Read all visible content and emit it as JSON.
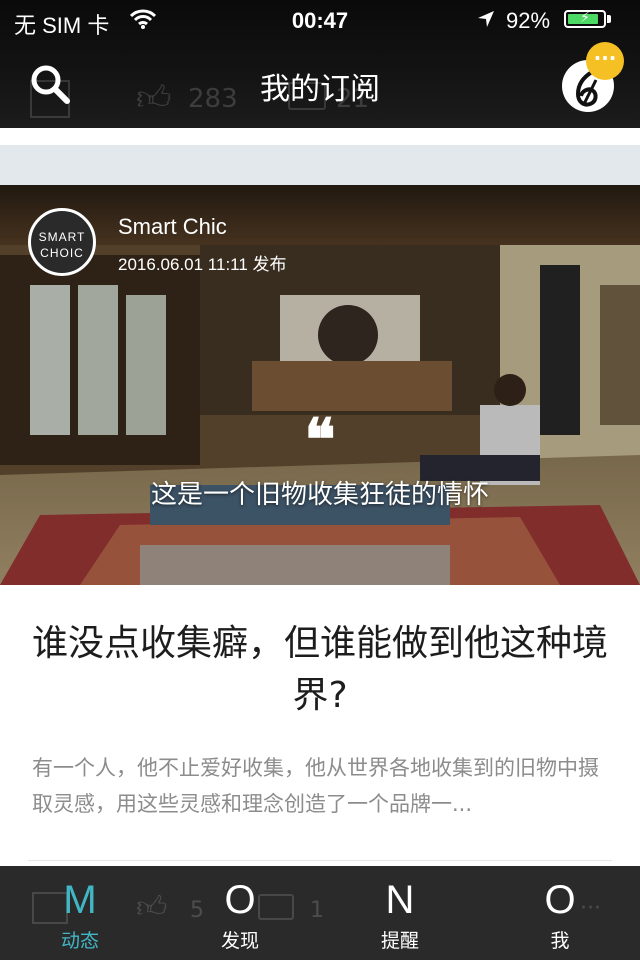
{
  "status_bar": {
    "carrier": "无 SIM 卡",
    "time": "00:47",
    "battery_percent": "92%",
    "battery_level": 0.92,
    "battery_color": "#4cd964"
  },
  "nav": {
    "title": "我的订阅",
    "search_icon": "search-icon",
    "badge_text": "···",
    "badge_color": "#f5c023"
  },
  "background_toolbar": {
    "like_count": "283",
    "comment_count": "21"
  },
  "card": {
    "author": "Smart Chic",
    "logo_line1": "SMART",
    "logo_line2": "CHOIC",
    "published": "2016.06.01 11:11 发布",
    "quote_mark": "❝",
    "quote": "这是一个旧物收集狂徒的情怀",
    "title": "谁没点收集癖，但谁能做到他这种境界?",
    "summary": "有一个人，他不止爱好收集，他从世界各地收集到的旧物中摄取灵感，用这些灵感和理念创造了一个品牌一..."
  },
  "tab_ghost": {
    "like_count": "5",
    "comment_count": "1"
  },
  "tabs": [
    {
      "glyph": "M",
      "label": "动态",
      "active": true
    },
    {
      "glyph": "O",
      "label": "发现",
      "active": false
    },
    {
      "glyph": "N",
      "label": "提醒",
      "active": false
    },
    {
      "glyph": "O",
      "label": "我",
      "active": false
    }
  ],
  "colors": {
    "accent": "#41b7c6",
    "header_bg": "#141414",
    "separator": "#e3e8ec"
  }
}
